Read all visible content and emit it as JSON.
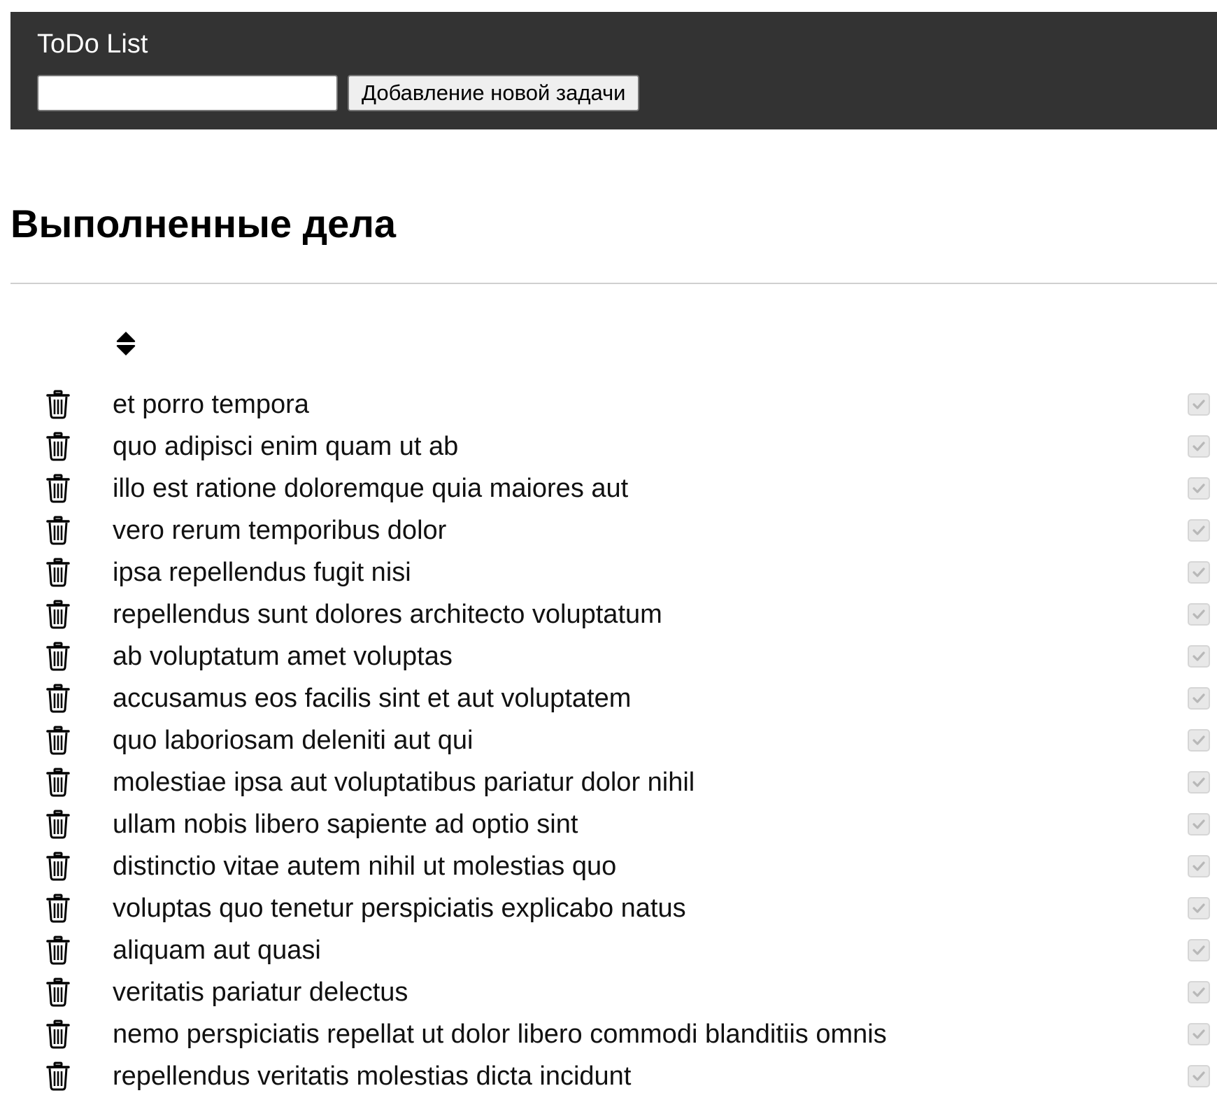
{
  "header": {
    "title": "ToDo List",
    "input_value": "",
    "input_placeholder": "",
    "add_button_label": "Добавление новой задачи",
    "background_color": "#333333"
  },
  "section": {
    "title": "Выполненные дела",
    "sort_icon": "sort-icon"
  },
  "todos": [
    {
      "text": "et porro tempora",
      "completed": true
    },
    {
      "text": "quo adipisci enim quam ut ab",
      "completed": true
    },
    {
      "text": "illo est ratione doloremque quia maiores aut",
      "completed": true
    },
    {
      "text": "vero rerum temporibus dolor",
      "completed": true
    },
    {
      "text": "ipsa repellendus fugit nisi",
      "completed": true
    },
    {
      "text": "repellendus sunt dolores architecto voluptatum",
      "completed": true
    },
    {
      "text": "ab voluptatum amet voluptas",
      "completed": true
    },
    {
      "text": "accusamus eos facilis sint et aut voluptatem",
      "completed": true
    },
    {
      "text": "quo laboriosam deleniti aut qui",
      "completed": true
    },
    {
      "text": "molestiae ipsa aut voluptatibus pariatur dolor nihil",
      "completed": true
    },
    {
      "text": "ullam nobis libero sapiente ad optio sint",
      "completed": true
    },
    {
      "text": "distinctio vitae autem nihil ut molestias quo",
      "completed": true
    },
    {
      "text": "voluptas quo tenetur perspiciatis explicabo natus",
      "completed": true
    },
    {
      "text": "aliquam aut quasi",
      "completed": true
    },
    {
      "text": "veritatis pariatur delectus",
      "completed": true
    },
    {
      "text": "nemo perspiciatis repellat ut dolor libero commodi blanditiis omnis",
      "completed": true
    },
    {
      "text": "repellendus veritatis molestias dicta incidunt",
      "completed": true
    }
  ],
  "icons": {
    "delete": "trash-icon",
    "completed": "checkbox-checked-icon"
  }
}
